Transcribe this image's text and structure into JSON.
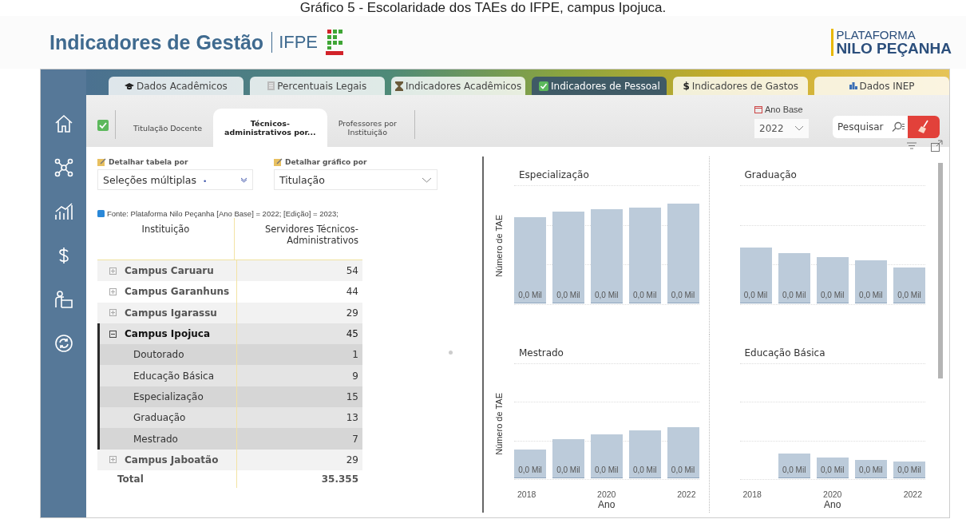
{
  "caption": "Gráfico 5 - Escolaridade dos TAEs do IFPE, campus Ipojuca.",
  "header": {
    "title": "Indicadores de Gestão",
    "org": "IFPE",
    "brand_top": "PLATAFORMA",
    "brand_main": "NILO PEÇANHA"
  },
  "tabs": [
    {
      "label": "Dados Acadêmicos",
      "kind": "cap",
      "selected": false
    },
    {
      "label": "Percentuais Legais",
      "kind": "doc",
      "selected": false
    },
    {
      "label": "Indicadores Acadêmicos",
      "kind": "hourglass",
      "selected": false
    },
    {
      "label": "Indicadores de Pessoal",
      "kind": "check",
      "selected": true
    },
    {
      "label": "Indicadores de Gastos",
      "kind": "symbol",
      "symbol": "$",
      "selected": false
    },
    {
      "label": "Dados INEP",
      "kind": "chart",
      "selected": false
    }
  ],
  "subtabs": [
    {
      "label": "Titulação Docente",
      "selected": false
    },
    {
      "label": "Técnicos-\nadministrativos por...",
      "selected": true
    },
    {
      "label": "Professores por\nInstituição",
      "selected": false
    }
  ],
  "filters": {
    "year_label": "Ano Base",
    "year": "2022",
    "search_placeholder": "Pesquisar"
  },
  "table_filter": {
    "label": "Detalhar tabela por",
    "value": "Seleções múltiplas",
    "indicator": "•"
  },
  "chart_filter": {
    "label": "Detalhar gráfico por",
    "value": "Titulação"
  },
  "source": "Fonte: Plataforma Nilo Peçanha [Ano Base] = 2022; [Edição] = 2023;",
  "table": {
    "columns": [
      "Instituição",
      "Servidores Técnicos-\nAdministrativos"
    ],
    "rows": [
      {
        "name": "Campus Caruaru",
        "value": "54",
        "expanded": false,
        "selected": false,
        "children": []
      },
      {
        "name": "Campus Garanhuns",
        "value": "44",
        "expanded": false,
        "selected": false,
        "children": []
      },
      {
        "name": "Campus Igarassu",
        "value": "29",
        "expanded": false,
        "selected": false,
        "children": []
      },
      {
        "name": "Campus Ipojuca",
        "value": "45",
        "expanded": true,
        "selected": true,
        "children": [
          {
            "name": "Doutorado",
            "value": "1"
          },
          {
            "name": "Educação Básica",
            "value": "9"
          },
          {
            "name": "Especialização",
            "value": "15"
          },
          {
            "name": "Graduação",
            "value": "13"
          },
          {
            "name": "Mestrado",
            "value": "7"
          }
        ]
      },
      {
        "name": "Campus Jaboatão",
        "value": "29",
        "expanded": false,
        "selected": false,
        "children": []
      }
    ],
    "total": {
      "name": "Total",
      "value": "35.355"
    }
  },
  "charts": [
    {
      "title": "Especialização",
      "ylabel": "Número de TAE",
      "bars": [
        "0,0 Mil",
        "0,0 Mil",
        "0,0 Mil",
        "0,0 Mil",
        "0,0 Mil"
      ]
    },
    {
      "title": "Graduação",
      "bars": [
        "0,0 Mil",
        "0,0 Mil",
        "0,0 Mil",
        "0,0 Mil",
        "0,0 Mil"
      ]
    },
    {
      "title": "Mestrado",
      "ylabel": "Número de TAE",
      "bars": [
        "0,0 Mil",
        "0,0 Mil",
        "0,0 Mil",
        "0,0 Mil",
        "0,0 Mil"
      ],
      "xticks": [
        "2018",
        "2020",
        "2022"
      ],
      "xlabel": "Ano"
    },
    {
      "title": "Educação Básica",
      "bars": [
        "0,0 Mil",
        "0,0 Mil",
        "0,0 Mil",
        "0,0 Mil"
      ],
      "xticks": [
        "2018",
        "2020",
        "2022"
      ],
      "xlabel": "Ano"
    }
  ]
}
